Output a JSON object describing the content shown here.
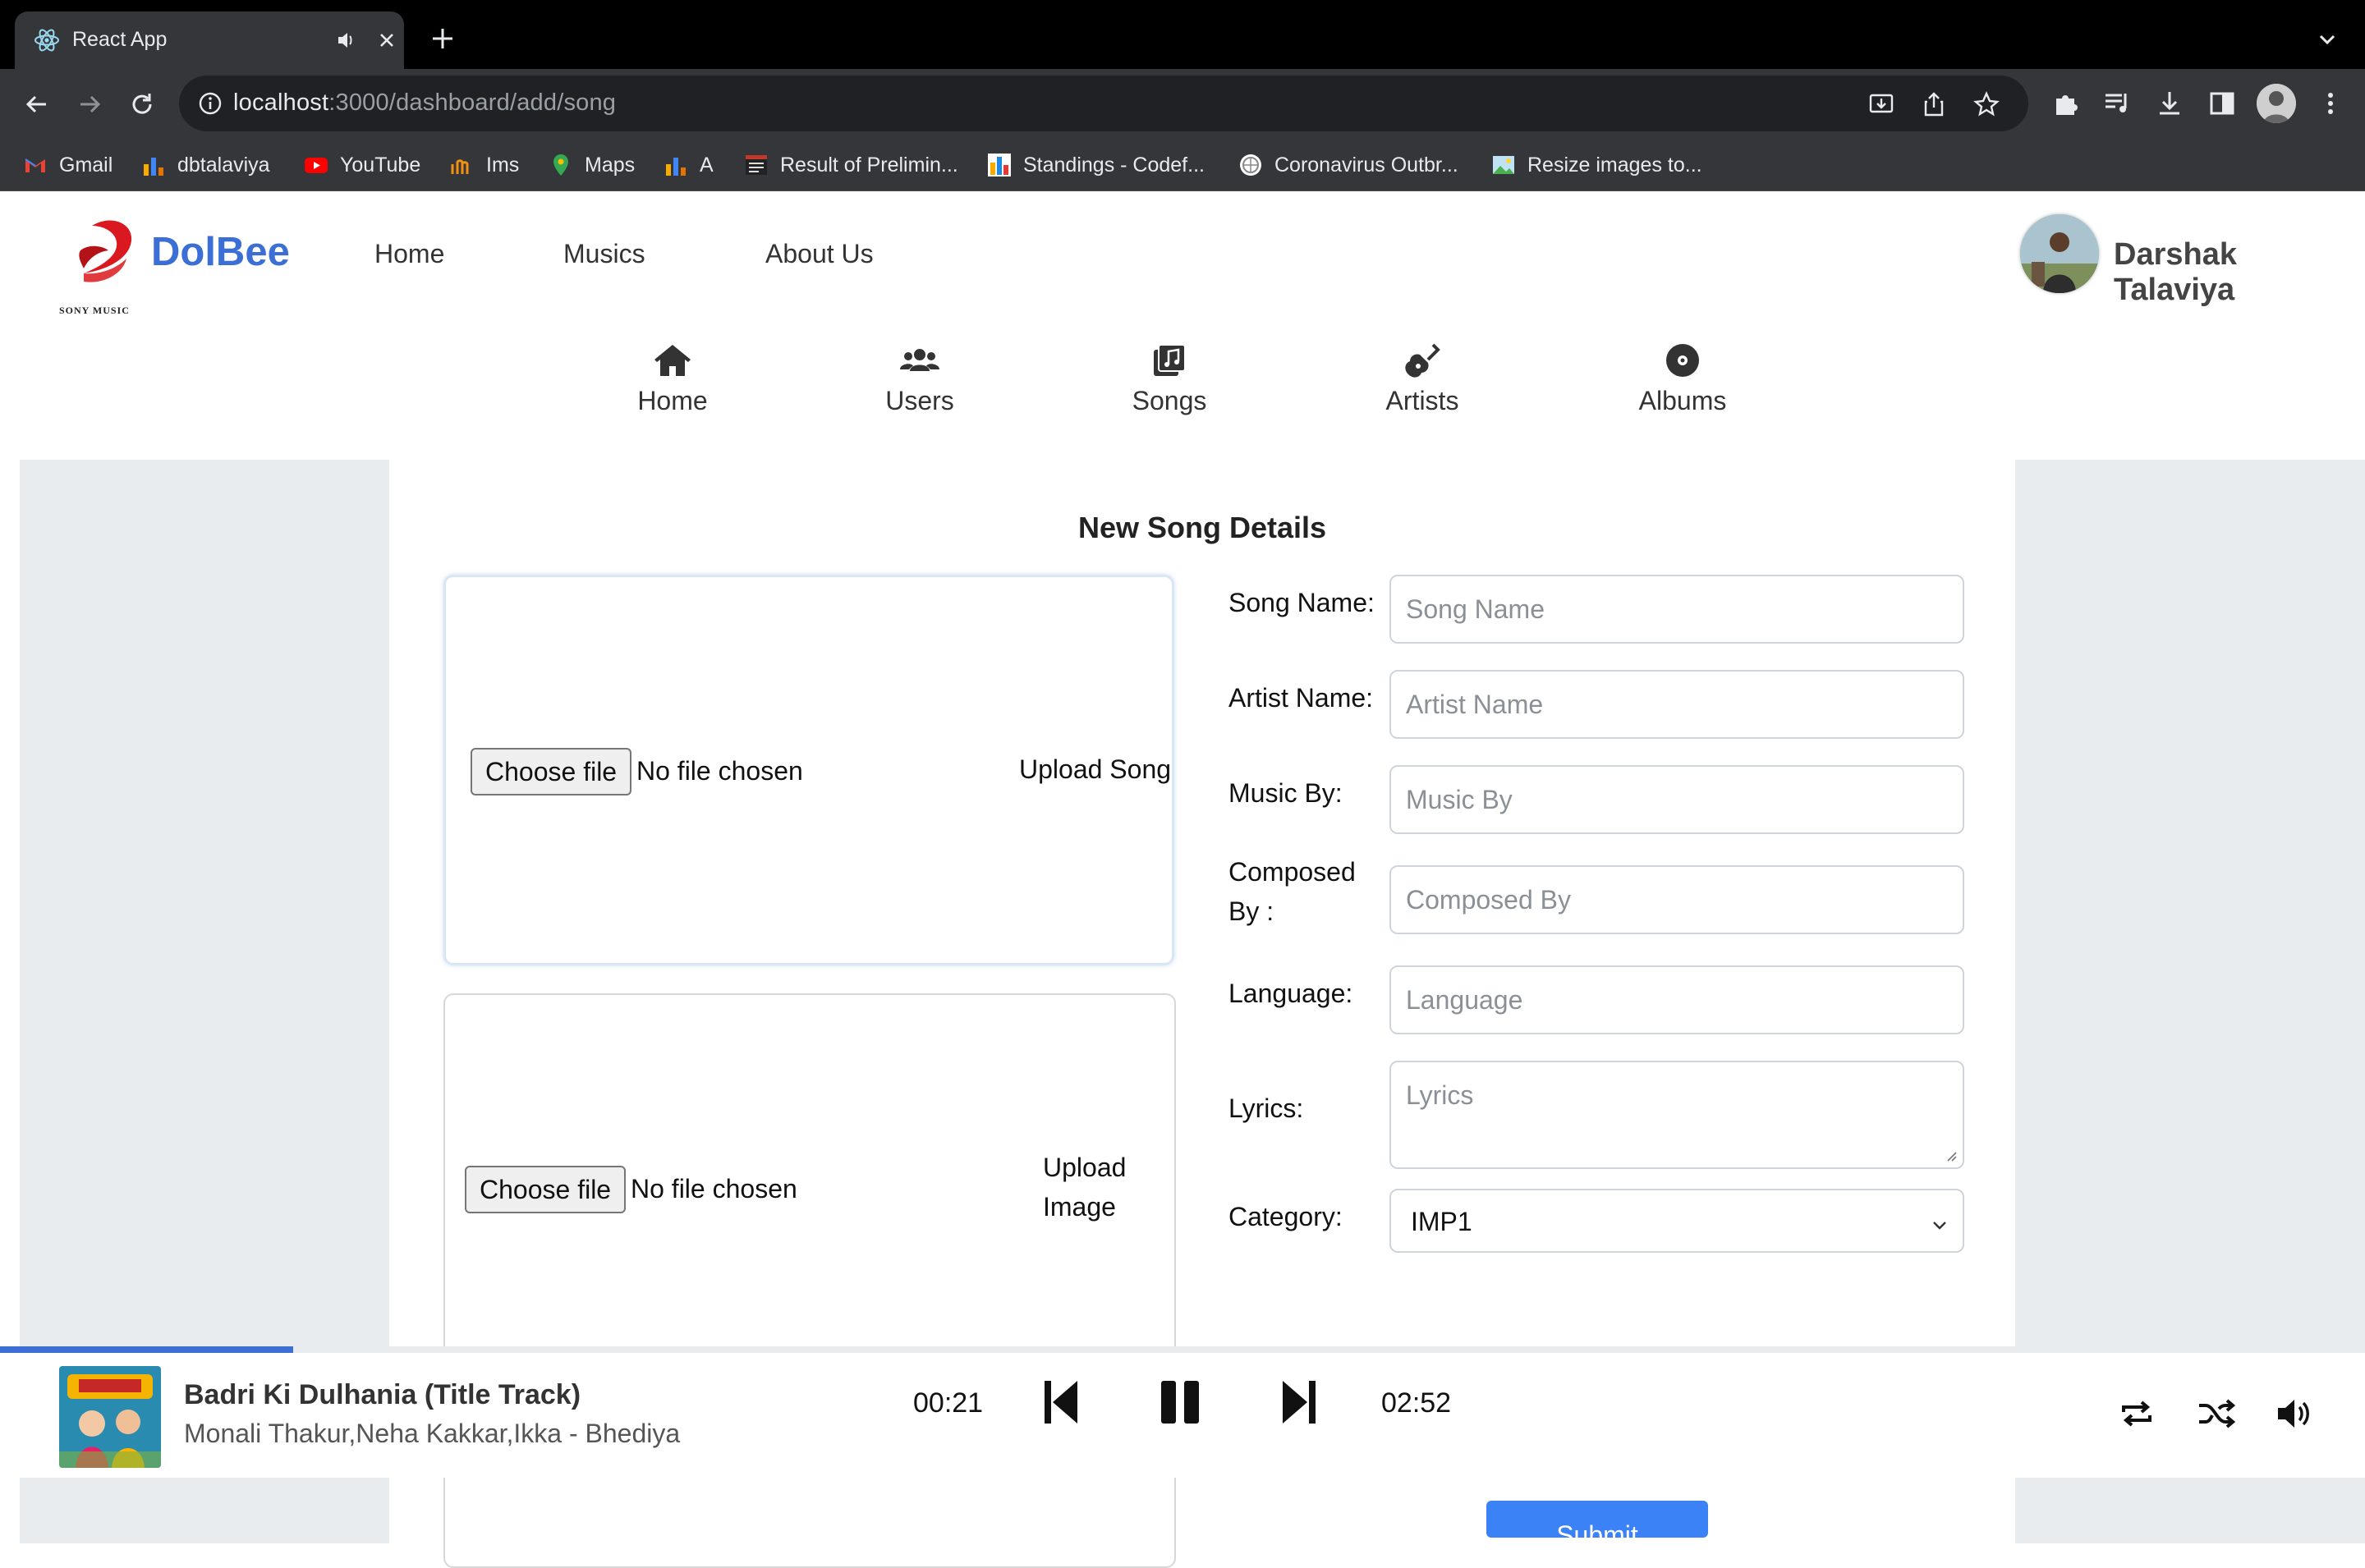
{
  "browser": {
    "tab_title": "React App",
    "url_host": "localhost",
    "url_path": ":3000/dashboard/add/song",
    "bookmarks": [
      {
        "label": "Gmail",
        "icon": "gmail-icon"
      },
      {
        "label": "dbtalaviya",
        "icon": "chart-icon"
      },
      {
        "label": "YouTube",
        "icon": "youtube-icon"
      },
      {
        "label": "Ims",
        "icon": "ims-icon"
      },
      {
        "label": "Maps",
        "icon": "maps-icon"
      },
      {
        "label": "A",
        "icon": "chart-icon"
      },
      {
        "label": "Result of Prelimin...",
        "icon": "page-icon"
      },
      {
        "label": "Standings - Codef...",
        "icon": "chart-icon"
      },
      {
        "label": "Coronavirus Outbr...",
        "icon": "globe-icon"
      },
      {
        "label": "Resize images to...",
        "icon": "image-icon"
      }
    ]
  },
  "header": {
    "brand": "DolBee",
    "logo_caption": "SONY MUSIC",
    "nav": [
      "Home",
      "Musics",
      "About Us"
    ],
    "user_name": "Darshak Talaviya"
  },
  "dashboard_nav": [
    {
      "label": "Home",
      "icon": "home-icon"
    },
    {
      "label": "Users",
      "icon": "users-icon"
    },
    {
      "label": "Songs",
      "icon": "songs-icon"
    },
    {
      "label": "Artists",
      "icon": "guitar-icon"
    },
    {
      "label": "Albums",
      "icon": "disc-icon"
    }
  ],
  "form": {
    "title": "New Song Details",
    "upload_song": {
      "button": "Choose file",
      "status": "No file chosen",
      "label": "Upload Song"
    },
    "upload_image": {
      "button": "Choose file",
      "status": "No file chosen",
      "label_line1": "Upload",
      "label_line2": "Image"
    },
    "fields": {
      "song_name": {
        "label": "Song Name:",
        "placeholder": "Song Name"
      },
      "artist_name": {
        "label": "Artist Name:",
        "placeholder": "Artist Name"
      },
      "music_by": {
        "label": "Music By:",
        "placeholder": "Music By"
      },
      "composed_by": {
        "label_line1": "Composed",
        "label_line2": "By :",
        "placeholder": "Composed By"
      },
      "language": {
        "label": "Language:",
        "placeholder": "Language"
      },
      "lyrics": {
        "label": "Lyrics:",
        "placeholder": "Lyrics"
      },
      "category": {
        "label": "Category:",
        "value": "IMP1"
      }
    },
    "submit": "Submit"
  },
  "player": {
    "track_title": "Badri Ki Dulhania (Title Track)",
    "track_artists": "Monali Thakur,Neha Kakkar,Ikka - Bhediya",
    "elapsed": "00:21",
    "duration": "02:52",
    "progress_fraction": 0.124
  },
  "colors": {
    "brand": "#3b6fd6",
    "submit": "#3b82f6",
    "browser_dark": "#35363a",
    "panel_gray": "#e9ecef"
  }
}
